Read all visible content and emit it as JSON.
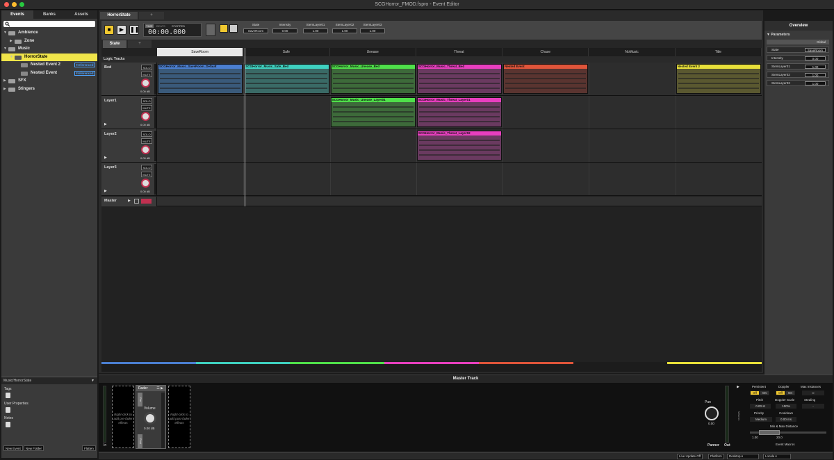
{
  "window": {
    "title": "SCGHorror_FMOD.fspro - Event Editor"
  },
  "left_tabs": [
    "Events",
    "Banks",
    "Assets"
  ],
  "tree": [
    {
      "label": "Ambience",
      "depth": 0,
      "kind": "folder",
      "open": true,
      "selected": false,
      "ref": ""
    },
    {
      "label": "Zone",
      "depth": 1,
      "kind": "folder",
      "open": false,
      "selected": false,
      "ref": ""
    },
    {
      "label": "Music",
      "depth": 0,
      "kind": "folder",
      "open": true,
      "selected": false,
      "ref": ""
    },
    {
      "label": "HorrorState",
      "depth": 1,
      "kind": "event",
      "open": true,
      "selected": true,
      "ref": ""
    },
    {
      "label": "Nested Event 2",
      "depth": 2,
      "kind": "event",
      "open": false,
      "selected": false,
      "ref": "#referenced"
    },
    {
      "label": "Nested Event",
      "depth": 2,
      "kind": "event",
      "open": false,
      "selected": false,
      "ref": "#referenced"
    },
    {
      "label": "SFX",
      "depth": 0,
      "kind": "folder",
      "open": false,
      "selected": false,
      "ref": ""
    },
    {
      "label": "Stingers",
      "depth": 0,
      "kind": "folder",
      "open": false,
      "selected": false,
      "ref": ""
    }
  ],
  "props_panel": {
    "path": "Music/HorrorState",
    "tags_label": "Tags",
    "user_props_label": "User Properties",
    "notes_label": "Notes",
    "new_event": "New Event",
    "new_folder": "New Folder",
    "flatten": "Flatten"
  },
  "editor_tab": "HorrorState",
  "editor_tab_add": "+",
  "transport": {
    "time_mode": "TIME",
    "beats_mode": "BEATS",
    "status": "STOPPED",
    "time": "00:00.000"
  },
  "parameters_bar": [
    {
      "label": "State",
      "value": "SaveRoom"
    },
    {
      "label": "Intensity",
      "value": "0.00"
    },
    {
      "label": "StemLayer01",
      "value": "1.00"
    },
    {
      "label": "StemLayer02",
      "value": "1.00"
    },
    {
      "label": "StemLayer03",
      "value": "1.00"
    }
  ],
  "sheet_tab": "State",
  "sheet_tab_add": "+",
  "logic_tracks_label": "Logic Tracks",
  "ruler": [
    "SaveRoom",
    "Safe",
    "Unease",
    "Threat",
    "Chase",
    "NoMusic",
    "Title"
  ],
  "tracks": [
    {
      "name": "Bed",
      "solo": "SOLO",
      "mute": "MUTE",
      "db": "0.00 dB"
    },
    {
      "name": "Layer1",
      "solo": "SOLO",
      "mute": "MUTE",
      "db": "0.00 dB"
    },
    {
      "name": "Layer2",
      "solo": "SOLO",
      "mute": "MUTE",
      "db": "0.00 dB"
    },
    {
      "name": "Layer3",
      "solo": "SOLO",
      "mute": "MUTE",
      "db": "0.00 dB"
    }
  ],
  "master_track_label": "Master",
  "regions": [
    {
      "label": "SCGHorror_Music_SaveRoom_Default",
      "track": 0,
      "col": 0,
      "color": "#4b7fd1",
      "body": "#3a5a7a"
    },
    {
      "label": "SCGHorror_Music_Safe_Bed",
      "track": 0,
      "col": 1,
      "color": "#3fd1c0",
      "body": "#3a6a66"
    },
    {
      "label": "SCGHorror_Music_Unease_Bed",
      "track": 0,
      "col": 2,
      "color": "#4fe04a",
      "body": "#3d6a3a"
    },
    {
      "label": "SCGHorror_Music_Threat_Bed",
      "track": 0,
      "col": 3,
      "color": "#e83fbf",
      "body": "#6a3a60"
    },
    {
      "label": "Nested Event",
      "track": 0,
      "col": 4,
      "color": "#e0553a",
      "body": "#5a3430"
    },
    {
      "label": "Nested Event 2",
      "track": 0,
      "col": 6,
      "color": "#e8e03a",
      "body": "#5a5830"
    },
    {
      "label": "SCGHorror_Music_Unease_Layer01",
      "track": 1,
      "col": 2,
      "color": "#4fe04a",
      "body": "#3d6a3a"
    },
    {
      "label": "SCGHorror_Music_Threat_Layer01",
      "track": 1,
      "col": 3,
      "color": "#e83fbf",
      "body": "#6a3a60"
    },
    {
      "label": "SCGHorror_Music_Threat_Layer02",
      "track": 2,
      "col": 3,
      "color": "#e83fbf",
      "body": "#6a3a60"
    }
  ],
  "overview": {
    "title": "Overview",
    "section": "Parameters",
    "group": "Global",
    "rows": [
      {
        "label": "State",
        "value": "SaveRoom"
      },
      {
        "label": "Intensity",
        "value": "0.00"
      },
      {
        "label": "StemLayer01",
        "value": "1.00"
      },
      {
        "label": "StemLayer02",
        "value": "1.00"
      },
      {
        "label": "StemLayer03",
        "value": "1.00"
      }
    ]
  },
  "master": {
    "title": "Master Track",
    "pre_fader": "Right-click to add pre-fader effects",
    "post_fader": "Right-click to add post-fader effects",
    "fader": "Fader",
    "volume": "Volume",
    "volume_db": "0.00 dB",
    "pre": "Pre",
    "post": "Post",
    "in": "In",
    "pan": "Pan",
    "pan_value": "0.00",
    "panner": "Panner",
    "out": "Out",
    "macros": "Macros"
  },
  "macros": {
    "persistent": "Persistent",
    "doppler": "Doppler",
    "max_instances": "Max Instances",
    "off": "Off",
    "on": "On",
    "max_inst_val": "∞",
    "pitch": "Pitch",
    "pitch_val": "0.00 st",
    "doppler_scale": "Doppler Scale",
    "doppler_scale_val": "100%",
    "stealing": "Stealing",
    "stealing_val": "-",
    "priority": "Priority",
    "priority_val": "Medium",
    "cooldown": "Cooldown",
    "cooldown_val": "0.00 ms",
    "min_max": "Min & Max Distance",
    "dist_min": "1.00",
    "dist_max": "20.0",
    "event_macros": "Event Macros"
  },
  "statusbar": {
    "live_update": "Live Update Off",
    "platform": "Platform",
    "platform_val": "Desktop",
    "locale": "Locale"
  },
  "colors": {
    "accent": "#f0e54a",
    "selected": "#f0e54a",
    "fader_red": "#c03050"
  }
}
